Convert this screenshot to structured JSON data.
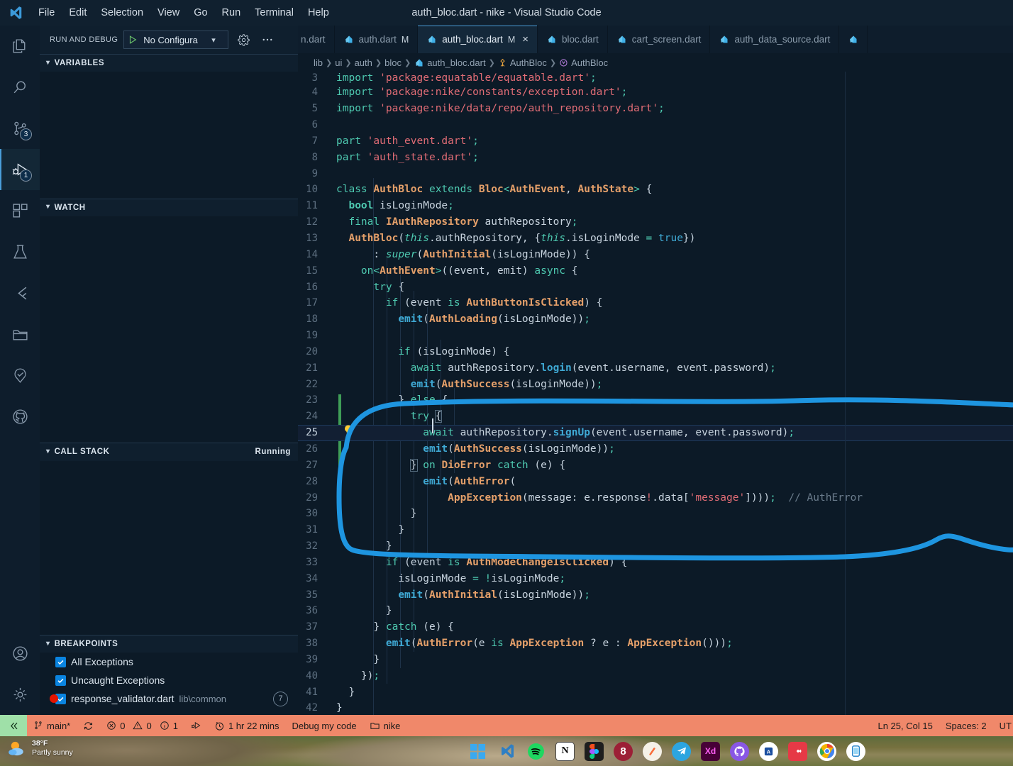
{
  "titlebar": {
    "window_title": "auth_bloc.dart - nike - Visual Studio Code",
    "menus": [
      "File",
      "Edit",
      "Selection",
      "View",
      "Go",
      "Run",
      "Terminal",
      "Help"
    ]
  },
  "activitybar": {
    "items": [
      {
        "name": "explorer",
        "icon": "files-icon",
        "badge": ""
      },
      {
        "name": "search",
        "icon": "search-icon",
        "badge": ""
      },
      {
        "name": "source-control",
        "icon": "source-control-icon",
        "badge": "3"
      },
      {
        "name": "run-and-debug",
        "icon": "run-and-debug-icon",
        "badge": "1"
      },
      {
        "name": "extensions",
        "icon": "extensions-icon",
        "badge": ""
      },
      {
        "name": "testing",
        "icon": "beaker-icon",
        "badge": ""
      },
      {
        "name": "flutter",
        "icon": "flutter-icon",
        "badge": ""
      },
      {
        "name": "project-manager",
        "icon": "folder-icon",
        "badge": ""
      },
      {
        "name": "dependency-tree",
        "icon": "tree-icon",
        "badge": ""
      },
      {
        "name": "github",
        "icon": "github-icon",
        "badge": ""
      }
    ],
    "bottom": [
      {
        "name": "accounts",
        "icon": "account-icon"
      },
      {
        "name": "settings",
        "icon": "gear-icon"
      }
    ]
  },
  "sidebar": {
    "toolbar": {
      "title": "RUN AND DEBUG",
      "config_value": "No Configura",
      "play_icon": "play-icon",
      "gear_icon": "gear-icon",
      "more_icon": "ellipsis-icon"
    },
    "panels": [
      {
        "title": "VARIABLES",
        "tail": ""
      },
      {
        "title": "WATCH",
        "tail": ""
      },
      {
        "title": "CALL STACK",
        "tail": "Running"
      },
      {
        "title": "BREAKPOINTS",
        "tail": ""
      }
    ],
    "breakpoints": [
      {
        "label": "All Exceptions",
        "checked": true,
        "sub": "",
        "count": "",
        "dot": false
      },
      {
        "label": "Uncaught Exceptions",
        "checked": true,
        "sub": "",
        "count": "",
        "dot": false
      },
      {
        "label": "response_validator.dart",
        "checked": true,
        "sub": "lib\\common",
        "count": "7",
        "dot": true
      }
    ]
  },
  "editor": {
    "tabs": [
      {
        "label": "n.dart",
        "modified": "",
        "active": false,
        "icon": "dart-icon",
        "partial": true
      },
      {
        "label": "auth.dart",
        "modified": "M",
        "active": false,
        "icon": "dart-icon"
      },
      {
        "label": "auth_bloc.dart",
        "modified": "M",
        "active": true,
        "icon": "dart-icon",
        "close": "×"
      },
      {
        "label": "bloc.dart",
        "modified": "",
        "active": false,
        "icon": "dart-icon"
      },
      {
        "label": "cart_screen.dart",
        "modified": "",
        "active": false,
        "icon": "dart-icon"
      },
      {
        "label": "auth_data_source.dart",
        "modified": "",
        "active": false,
        "icon": "dart-icon"
      }
    ],
    "breadcrumbs": [
      {
        "label": "lib",
        "icon": ""
      },
      {
        "label": "ui",
        "icon": ""
      },
      {
        "label": "auth",
        "icon": ""
      },
      {
        "label": "bloc",
        "icon": ""
      },
      {
        "label": "auth_bloc.dart",
        "icon": "dart-icon"
      },
      {
        "label": "AuthBloc",
        "icon": "class-icon"
      },
      {
        "label": "AuthBloc",
        "icon": "method-icon"
      }
    ],
    "inlay_comment": "// AuthError",
    "highlighted_line": 25,
    "lines": [
      {
        "n": "3",
        "text": "import 'package:equatable/equatable.dart';"
      },
      {
        "n": "4",
        "text": "import 'package:nike/constants/exception.dart';"
      },
      {
        "n": "5",
        "text": "import 'package:nike/data/repo/auth_repository.dart';"
      },
      {
        "n": "6",
        "text": ""
      },
      {
        "n": "7",
        "text": "part 'auth_event.dart';"
      },
      {
        "n": "8",
        "text": "part 'auth_state.dart';"
      },
      {
        "n": "9",
        "text": ""
      },
      {
        "n": "10",
        "text": "class AuthBloc extends Bloc<AuthEvent, AuthState> {"
      },
      {
        "n": "11",
        "text": "  bool isLoginMode;"
      },
      {
        "n": "12",
        "text": "  final IAuthRepository authRepository;"
      },
      {
        "n": "13",
        "text": "  AuthBloc(this.authRepository, {this.isLoginMode = true})"
      },
      {
        "n": "14",
        "text": "      : super(AuthInitial(isLoginMode)) {"
      },
      {
        "n": "15",
        "text": "    on<AuthEvent>((event, emit) async {"
      },
      {
        "n": "16",
        "text": "      try {"
      },
      {
        "n": "17",
        "text": "        if (event is AuthButtonIsClicked) {"
      },
      {
        "n": "18",
        "text": "          emit(AuthLoading(isLoginMode));"
      },
      {
        "n": "19",
        "text": ""
      },
      {
        "n": "20",
        "text": "          if (isLoginMode) {"
      },
      {
        "n": "21",
        "text": "            await authRepository.login(event.username, event.password);"
      },
      {
        "n": "22",
        "text": "            emit(AuthSuccess(isLoginMode));"
      },
      {
        "n": "23",
        "text": "          } else {"
      },
      {
        "n": "24",
        "text": "            try {"
      },
      {
        "n": "25",
        "text": "              await authRepository.signUp(event.username, event.password);"
      },
      {
        "n": "26",
        "text": "              emit(AuthSuccess(isLoginMode));"
      },
      {
        "n": "27",
        "text": "            } on DioError catch (e) {"
      },
      {
        "n": "28",
        "text": "              emit(AuthError("
      },
      {
        "n": "29",
        "text": "                  AppException(message: e.response!.data['message'])));"
      },
      {
        "n": "30",
        "text": "            }"
      },
      {
        "n": "31",
        "text": "          }"
      },
      {
        "n": "32",
        "text": "        }"
      },
      {
        "n": "33",
        "text": "        if (event is AuthModeChangeIsClicked) {"
      },
      {
        "n": "34",
        "text": "          isLoginMode = !isLoginMode;"
      },
      {
        "n": "35",
        "text": "          emit(AuthInitial(isLoginMode));"
      },
      {
        "n": "36",
        "text": "        }"
      },
      {
        "n": "37",
        "text": "      } catch (e) {"
      },
      {
        "n": "38",
        "text": "        emit(AuthError(e is AppException ? e : AppException()));"
      },
      {
        "n": "39",
        "text": "      }"
      },
      {
        "n": "40",
        "text": "    });"
      },
      {
        "n": "41",
        "text": "  }"
      },
      {
        "n": "42",
        "text": "}"
      }
    ]
  },
  "statusbar": {
    "remote_icon": "remote-window-icon",
    "branch": "main*",
    "sync_icon": "sync-icon",
    "errors": "0",
    "warnings": "0",
    "infos": "1",
    "bug_icon": "debug-icon",
    "timer": "1 hr 22 mins",
    "debug_task": "Debug my code",
    "project": "nike",
    "cursor_position": "Ln 25, Col 15",
    "spaces": "Spaces: 2",
    "encoding": "UT"
  },
  "desktop": {
    "weather": {
      "temp": "38°F",
      "condition": "Partly sunny",
      "icon": "partly-sunny-icon"
    },
    "taskbar": [
      {
        "name": "start",
        "label": "",
        "color": "#1a9bf0"
      },
      {
        "name": "vscode",
        "label": "",
        "color": "transparent"
      },
      {
        "name": "spotify",
        "label": "",
        "color": "#1ed760"
      },
      {
        "name": "notion",
        "label": "N",
        "color": "#ffffff"
      },
      {
        "name": "figma",
        "label": "",
        "color": "#1e1e1e"
      },
      {
        "name": "8",
        "label": "8",
        "color": "#9c1f36"
      },
      {
        "name": "pen",
        "label": "",
        "color": "#f5f1e8"
      },
      {
        "name": "telegram",
        "label": "",
        "color": "#2ca5e0"
      },
      {
        "name": "adobe-xd",
        "label": "Xd",
        "color": "#470137"
      },
      {
        "name": "github-desktop",
        "label": "",
        "color": "#8957e5"
      },
      {
        "name": "app-a",
        "label": "A",
        "color": "#ffffff"
      },
      {
        "name": "app-red",
        "label": "",
        "color": "#e63946"
      },
      {
        "name": "chrome",
        "label": "",
        "color": "#ffffff"
      },
      {
        "name": "phone-link",
        "label": "",
        "color": "#ffffff"
      }
    ]
  },
  "colors": {
    "accent": "#1e8fd5",
    "annotation": "#1e95e0",
    "statusbar_bg": "#f0886a",
    "editor_bg": "#0c1a27",
    "sidebar_bg": "#0f1f2e"
  }
}
